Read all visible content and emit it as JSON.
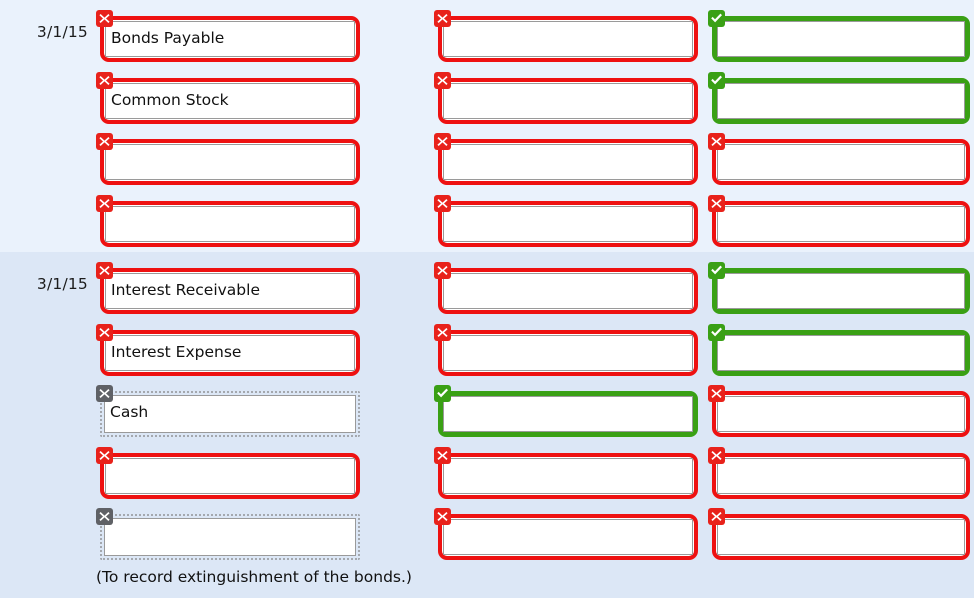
{
  "page": {
    "background_light": "#eaf2fc",
    "background_dark": "#dce7f6",
    "error_color": "#ee1111",
    "success_color": "#3aa015",
    "focus_color": "#3a9fdc",
    "neutral_color": "#a4a8ae"
  },
  "sections": [
    {
      "date": "3/1/15",
      "rows": [
        {
          "account": {
            "value": "Bonds Payable",
            "status": "error",
            "state": "normal"
          },
          "debit": {
            "value": "",
            "status": "error",
            "state": "normal"
          },
          "credit": {
            "value": "",
            "status": "correct",
            "state": "normal"
          }
        },
        {
          "account": {
            "value": "Common Stock",
            "status": "error",
            "state": "normal"
          },
          "debit": {
            "value": "",
            "status": "error",
            "state": "normal"
          },
          "credit": {
            "value": "",
            "status": "correct",
            "state": "normal"
          }
        },
        {
          "account": {
            "value": "",
            "status": "error",
            "state": "normal"
          },
          "debit": {
            "value": "",
            "status": "error",
            "state": "normal"
          },
          "credit": {
            "value": "",
            "status": "error",
            "state": "normal"
          }
        },
        {
          "account": {
            "value": "",
            "status": "error",
            "state": "normal"
          },
          "debit": {
            "value": "",
            "status": "error",
            "state": "normal"
          },
          "credit": {
            "value": "",
            "status": "error",
            "state": "normal"
          }
        }
      ]
    },
    {
      "date": "3/1/15",
      "rows": [
        {
          "account": {
            "value": "Interest Receivable",
            "status": "error",
            "state": "normal"
          },
          "debit": {
            "value": "",
            "status": "error",
            "state": "normal"
          },
          "credit": {
            "value": "",
            "status": "correct",
            "state": "normal"
          }
        },
        {
          "account": {
            "value": "Interest Expense",
            "status": "error",
            "state": "normal"
          },
          "debit": {
            "value": "",
            "status": "error",
            "state": "normal"
          },
          "credit": {
            "value": "",
            "status": "correct",
            "state": "normal"
          }
        },
        {
          "account": {
            "value": "Cash",
            "status": "unanswered",
            "state": "normal"
          },
          "debit": {
            "value": "",
            "status": "correct",
            "state": "normal"
          },
          "credit": {
            "value": "",
            "status": "error",
            "state": "normal"
          }
        },
        {
          "account": {
            "value": "",
            "status": "error",
            "state": "normal"
          },
          "debit": {
            "value": "",
            "status": "error",
            "state": "focused"
          },
          "credit": {
            "value": "",
            "status": "error",
            "state": "normal"
          }
        },
        {
          "account": {
            "value": "",
            "status": "unanswered",
            "state": "normal"
          },
          "debit": {
            "value": "",
            "status": "error",
            "state": "normal"
          },
          "credit": {
            "value": "",
            "status": "error",
            "state": "normal"
          }
        }
      ],
      "memo": "(To record extinguishment of the bonds.)"
    }
  ],
  "icons": {
    "error": "x-mark-icon",
    "correct": "check-mark-icon",
    "unanswered": "x-mark-gray-icon"
  }
}
